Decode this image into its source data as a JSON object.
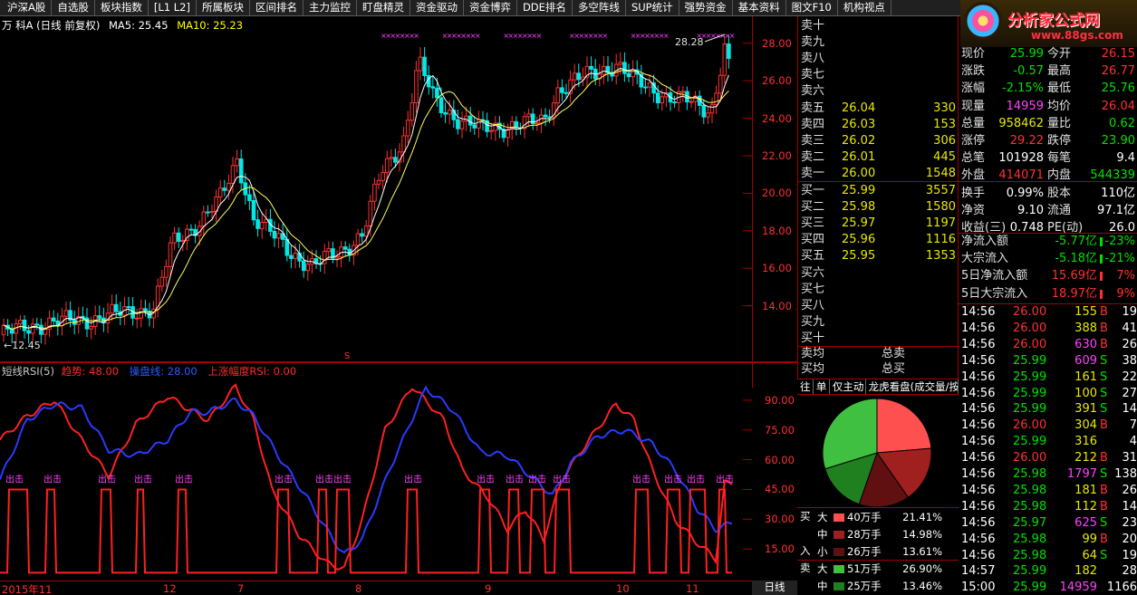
{
  "menu": [
    "沪深A股",
    "自选股",
    "板块指数",
    "[L1 L2]",
    "所属板块",
    "区间排名",
    "主力监控",
    "盯盘精灵",
    "资金驱动",
    "资金博弈",
    "DDE排名",
    "多空阵线",
    "SUP统计",
    "强势资金",
    "基本资料",
    "图文F10",
    "机构视点"
  ],
  "logo": {
    "brand": "分析家公式网",
    "url": "www.88gs.com"
  },
  "info": {
    "title": "万 科A (日线 前复权)",
    "ma5": "MA5: 25.45",
    "ma10": "MA10: 25.23"
  },
  "chart_data": [
    {
      "type": "candlestick",
      "title": "万 科A (日线 前复权)",
      "series": [
        {
          "name": "MA5: 25.45"
        },
        {
          "name": "MA10: 25.23"
        }
      ],
      "yticks": [
        "28.00",
        "26.00",
        "24.00",
        "22.00",
        "20.00",
        "18.00",
        "16.00",
        "14.00"
      ],
      "ylim": [
        12,
        29
      ],
      "annotations": [
        "28.28",
        "12.45"
      ],
      "xticks": [
        "2015年11",
        "12",
        "7",
        "8",
        "9",
        "10",
        "11"
      ]
    },
    {
      "type": "line",
      "title": "短线RSI(5)",
      "series": [
        {
          "name": "趋势: 48.00",
          "color": "#ff2020"
        },
        {
          "name": "操盘线: 28.00",
          "color": "#2a3aff"
        },
        {
          "name": "上涨幅度RSI: 0.00",
          "color": "#ff2020"
        }
      ],
      "yticks": [
        "90.00",
        "75.00",
        "60.00",
        "45.00",
        "30.00",
        "15.00"
      ],
      "ylim": [
        0,
        100
      ],
      "markers": "出击"
    }
  ],
  "rsi": {
    "name": "短线RSI(5)",
    "a": "趋势: 48.00",
    "b": "操盘线: 28.00",
    "c": "上涨幅度RSI: 0.00",
    "signal": "出击"
  },
  "period": "日线",
  "order_book": {
    "sell": [
      {
        "label": "卖十",
        "price": "",
        "vol": ""
      },
      {
        "label": "卖九",
        "price": "",
        "vol": ""
      },
      {
        "label": "卖八",
        "price": "",
        "vol": ""
      },
      {
        "label": "卖七",
        "price": "",
        "vol": ""
      },
      {
        "label": "卖六",
        "price": "",
        "vol": ""
      },
      {
        "label": "卖五",
        "price": "26.04",
        "vol": "330"
      },
      {
        "label": "卖四",
        "price": "26.03",
        "vol": "153"
      },
      {
        "label": "卖三",
        "price": "26.02",
        "vol": "306"
      },
      {
        "label": "卖二",
        "price": "26.01",
        "vol": "445"
      },
      {
        "label": "卖一",
        "price": "26.00",
        "vol": "1548"
      }
    ],
    "buy": [
      {
        "label": "买一",
        "price": "25.99",
        "vol": "3557"
      },
      {
        "label": "买二",
        "price": "25.98",
        "vol": "1580"
      },
      {
        "label": "买三",
        "price": "25.97",
        "vol": "1197"
      },
      {
        "label": "买四",
        "price": "25.96",
        "vol": "1116"
      },
      {
        "label": "买五",
        "price": "25.95",
        "vol": "1353"
      },
      {
        "label": "买六",
        "price": "",
        "vol": ""
      },
      {
        "label": "买七",
        "price": "",
        "vol": ""
      },
      {
        "label": "买八",
        "price": "",
        "vol": ""
      },
      {
        "label": "买九",
        "price": "",
        "vol": ""
      },
      {
        "label": "买十",
        "price": "",
        "vol": ""
      }
    ],
    "avg_sell": "卖均",
    "avg_buy": "买均",
    "total_sell": "总卖",
    "total_buy": "总买"
  },
  "tabs": [
    "往",
    "单",
    "仅主动",
    "龙虎看盘(成交量/按"
  ],
  "flow": {
    "buy_label": "买",
    "in_label": "入",
    "sell_label": "卖",
    "rows": [
      {
        "size": "大",
        "amount": "40万手",
        "pct": "21.41%",
        "color": "#ff5050"
      },
      {
        "size": "中",
        "amount": "28万手",
        "pct": "14.98%",
        "color": "#a02020"
      },
      {
        "size": "小",
        "amount": "26万手",
        "pct": "13.61%",
        "color": "#601010"
      },
      {
        "size": "大",
        "amount": "51万手",
        "pct": "26.90%",
        "color": "#40c040"
      },
      {
        "size": "中",
        "amount": "25万手",
        "pct": "13.46%",
        "color": "#208020"
      }
    ]
  },
  "stats": [
    {
      "l1": "现价",
      "v1": "25.99",
      "l2": "今开",
      "v2": "26.15",
      "c1": "grn",
      "c2": "red"
    },
    {
      "l1": "涨跌",
      "v1": "-0.57",
      "l2": "最高",
      "v2": "26.77",
      "c1": "grn",
      "c2": "red"
    },
    {
      "l1": "涨幅",
      "v1": "-2.15%",
      "l2": "最低",
      "v2": "25.76",
      "c1": "grn",
      "c2": "grn"
    },
    {
      "l1": "现量",
      "v1": "14959",
      "l2": "均价",
      "v2": "26.04",
      "c1": "mag",
      "c2": "red"
    },
    {
      "l1": "总量",
      "v1": "958462",
      "l2": "量比",
      "v2": "0.62",
      "c1": "yel",
      "c2": "grn"
    },
    {
      "l1": "涨停",
      "v1": "29.22",
      "l2": "跌停",
      "v2": "23.90",
      "c1": "red",
      "c2": "grn"
    },
    {
      "l1": "总笔",
      "v1": "101928",
      "l2": "每笔",
      "v2": "9.4",
      "c1": "wht",
      "c2": "wht"
    },
    {
      "l1": "外盘",
      "v1": "414071",
      "l2": "内盘",
      "v2": "544339",
      "c1": "red",
      "c2": "grn"
    },
    {
      "l1": "换手",
      "v1": "0.99%",
      "l2": "股本",
      "v2": "110亿",
      "c1": "wht",
      "c2": "wht"
    },
    {
      "l1": "净资",
      "v1": "9.10",
      "l2": "流通",
      "v2": "97.1亿",
      "c1": "wht",
      "c2": "wht"
    },
    {
      "l1": "收益(三)",
      "v1": "0.748",
      "l2": "PE(动)",
      "v2": "26.0",
      "c1": "wht",
      "c2": "wht"
    }
  ],
  "flows2": [
    {
      "label": "净流入额",
      "v1": "-5.77亿",
      "v2": "-23%",
      "c": "grn"
    },
    {
      "label": "大宗流入",
      "v1": "-5.18亿",
      "v2": "-21%",
      "c": "grn"
    },
    {
      "label": "5日净流入额",
      "v1": "15.69亿",
      "v2": "7%",
      "c": "red"
    },
    {
      "label": "5日大宗流入",
      "v1": "18.97亿",
      "v2": "9%",
      "c": "red"
    }
  ],
  "ticks": [
    {
      "t": "14:56",
      "p": "26.00",
      "v": "155",
      "b": "B",
      "n": "19",
      "pc": "red",
      "vc": "yel",
      "bc": "red"
    },
    {
      "t": "14:56",
      "p": "26.00",
      "v": "388",
      "b": "B",
      "n": "41",
      "pc": "red",
      "vc": "yel",
      "bc": "red"
    },
    {
      "t": "14:56",
      "p": "26.00",
      "v": "630",
      "b": "B",
      "n": "26",
      "pc": "red",
      "vc": "mag",
      "bc": "red"
    },
    {
      "t": "14:56",
      "p": "25.99",
      "v": "609",
      "b": "S",
      "n": "38",
      "pc": "grn",
      "vc": "mag",
      "bc": "grn"
    },
    {
      "t": "14:56",
      "p": "25.99",
      "v": "161",
      "b": "S",
      "n": "22",
      "pc": "grn",
      "vc": "yel",
      "bc": "grn"
    },
    {
      "t": "14:56",
      "p": "25.99",
      "v": "100",
      "b": "S",
      "n": "27",
      "pc": "grn",
      "vc": "yel",
      "bc": "grn"
    },
    {
      "t": "14:56",
      "p": "25.99",
      "v": "391",
      "b": "S",
      "n": "14",
      "pc": "grn",
      "vc": "yel",
      "bc": "grn"
    },
    {
      "t": "14:56",
      "p": "26.00",
      "v": "304",
      "b": "B",
      "n": "7",
      "pc": "red",
      "vc": "yel",
      "bc": "red"
    },
    {
      "t": "14:56",
      "p": "25.99",
      "v": "316",
      "b": "",
      "n": "4",
      "pc": "grn",
      "vc": "yel",
      "bc": "grn"
    },
    {
      "t": "14:56",
      "p": "26.00",
      "v": "212",
      "b": "B",
      "n": "31",
      "pc": "red",
      "vc": "yel",
      "bc": "red"
    },
    {
      "t": "14:56",
      "p": "25.98",
      "v": "1797",
      "b": "S",
      "n": "138",
      "pc": "grn",
      "vc": "mag",
      "bc": "grn"
    },
    {
      "t": "14:56",
      "p": "25.98",
      "v": "181",
      "b": "B",
      "n": "26",
      "pc": "grn",
      "vc": "yel",
      "bc": "red"
    },
    {
      "t": "14:56",
      "p": "25.98",
      "v": "112",
      "b": "B",
      "n": "14",
      "pc": "grn",
      "vc": "yel",
      "bc": "red"
    },
    {
      "t": "14:56",
      "p": "25.97",
      "v": "625",
      "b": "S",
      "n": "23",
      "pc": "grn",
      "vc": "mag",
      "bc": "grn"
    },
    {
      "t": "14:56",
      "p": "25.98",
      "v": "99",
      "b": "B",
      "n": "20",
      "pc": "grn",
      "vc": "yel",
      "bc": "red"
    },
    {
      "t": "14:56",
      "p": "25.98",
      "v": "64",
      "b": "S",
      "n": "19",
      "pc": "grn",
      "vc": "yel",
      "bc": "grn"
    },
    {
      "t": "14:57",
      "p": "25.99",
      "v": "182",
      "b": "",
      "n": "28",
      "pc": "grn",
      "vc": "yel",
      "bc": "grn"
    },
    {
      "t": "15:00",
      "p": "25.99",
      "v": "14959",
      "b": "",
      "n": "1166",
      "pc": "grn",
      "vc": "mag",
      "bc": "grn"
    }
  ]
}
